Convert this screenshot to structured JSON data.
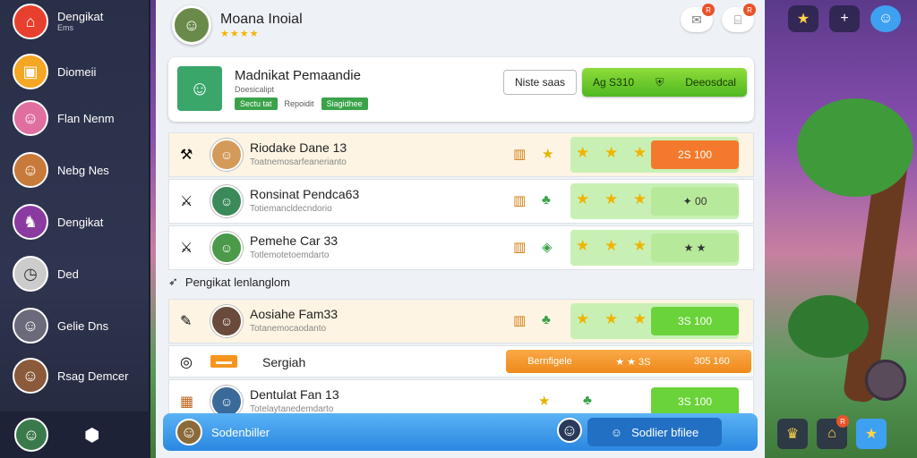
{
  "sidebar": {
    "items": [
      {
        "label": "Dengikat",
        "sub": "Ems",
        "icon": "home-icon",
        "color": "#e8402e"
      },
      {
        "label": "Diomeii",
        "icon": "scroll-icon",
        "color": "#f5a623"
      },
      {
        "label": "Flan Nenm",
        "icon": "character-icon",
        "color": "#e06fa0"
      },
      {
        "label": "Nebg Nes",
        "icon": "character-icon",
        "color": "#c87a3a"
      },
      {
        "label": "Dengikat",
        "icon": "dragon-icon",
        "color": "#8a3aa0"
      },
      {
        "label": "Ded",
        "icon": "clock-icon",
        "color": "#cccccc"
      },
      {
        "label": "Gelie Dns",
        "icon": "character-icon",
        "color": "#6a6a7a"
      },
      {
        "label": "Rsag Demcer",
        "icon": "character-icon",
        "color": "#8a5a3a"
      }
    ],
    "bottom_icons": [
      "avatar-icon",
      "cube-icon"
    ]
  },
  "topbar": {
    "title": "Moana Inoial",
    "stars": "★★★★"
  },
  "profile": {
    "name": "Madnikat Pemaandie",
    "sub": "Doesicalipt",
    "tag1": "Sectu tat",
    "tag2": "Repoidit",
    "tag3": "Siagidhee",
    "btn_white": "Niste saas",
    "btn_green_left": "Ag S310",
    "btn_green_right": "Deeosdcal"
  },
  "rows": [
    {
      "name": "Riodake Dane 13",
      "sub": "Toatnemosarfeanerianto",
      "pill": "2S 100",
      "pill_style": "orange",
      "stars": "★ ★ ★",
      "warm": true
    },
    {
      "name": "Ronsinat Pendca63",
      "sub": "Totiemancldecndorio",
      "pill": "✦ 00",
      "pill_style": "light",
      "stars": "★ ★ ★",
      "warm": false
    },
    {
      "name": "Pemehe Car 33",
      "sub": "Totlemotetoemdarto",
      "pill": "★ ★",
      "pill_style": "light",
      "stars": "★ ★ ★",
      "warm": false
    }
  ],
  "section": {
    "title": "Pengikat lenlanglom"
  },
  "rows2": [
    {
      "name": "Aosiahe Fam33",
      "sub": "Totanemocaodanto",
      "pill": "3S 100",
      "pill_style": "green",
      "stars": "★ ★ ★",
      "warm": true
    },
    {
      "name": "Sergiah",
      "tag": "Sergiah",
      "orange_bar": [
        "Bernfigele",
        "★ ★ 3S",
        "305 160"
      ]
    },
    {
      "name": "Dentulat Fan 13",
      "sub": "Totelaytanedemdarto",
      "pill": "3S 100",
      "pill_style": "green",
      "stars": "★",
      "warm": false
    }
  ],
  "bottom_bar": {
    "label": "Sodenbiller",
    "btn": "Sodlier bfilee"
  },
  "right_icons": {
    "top": [
      "star-icon",
      "plus-icon",
      "avatar-icon"
    ],
    "bottom": [
      "trophy-icon",
      "map-icon",
      "star-icon"
    ]
  }
}
